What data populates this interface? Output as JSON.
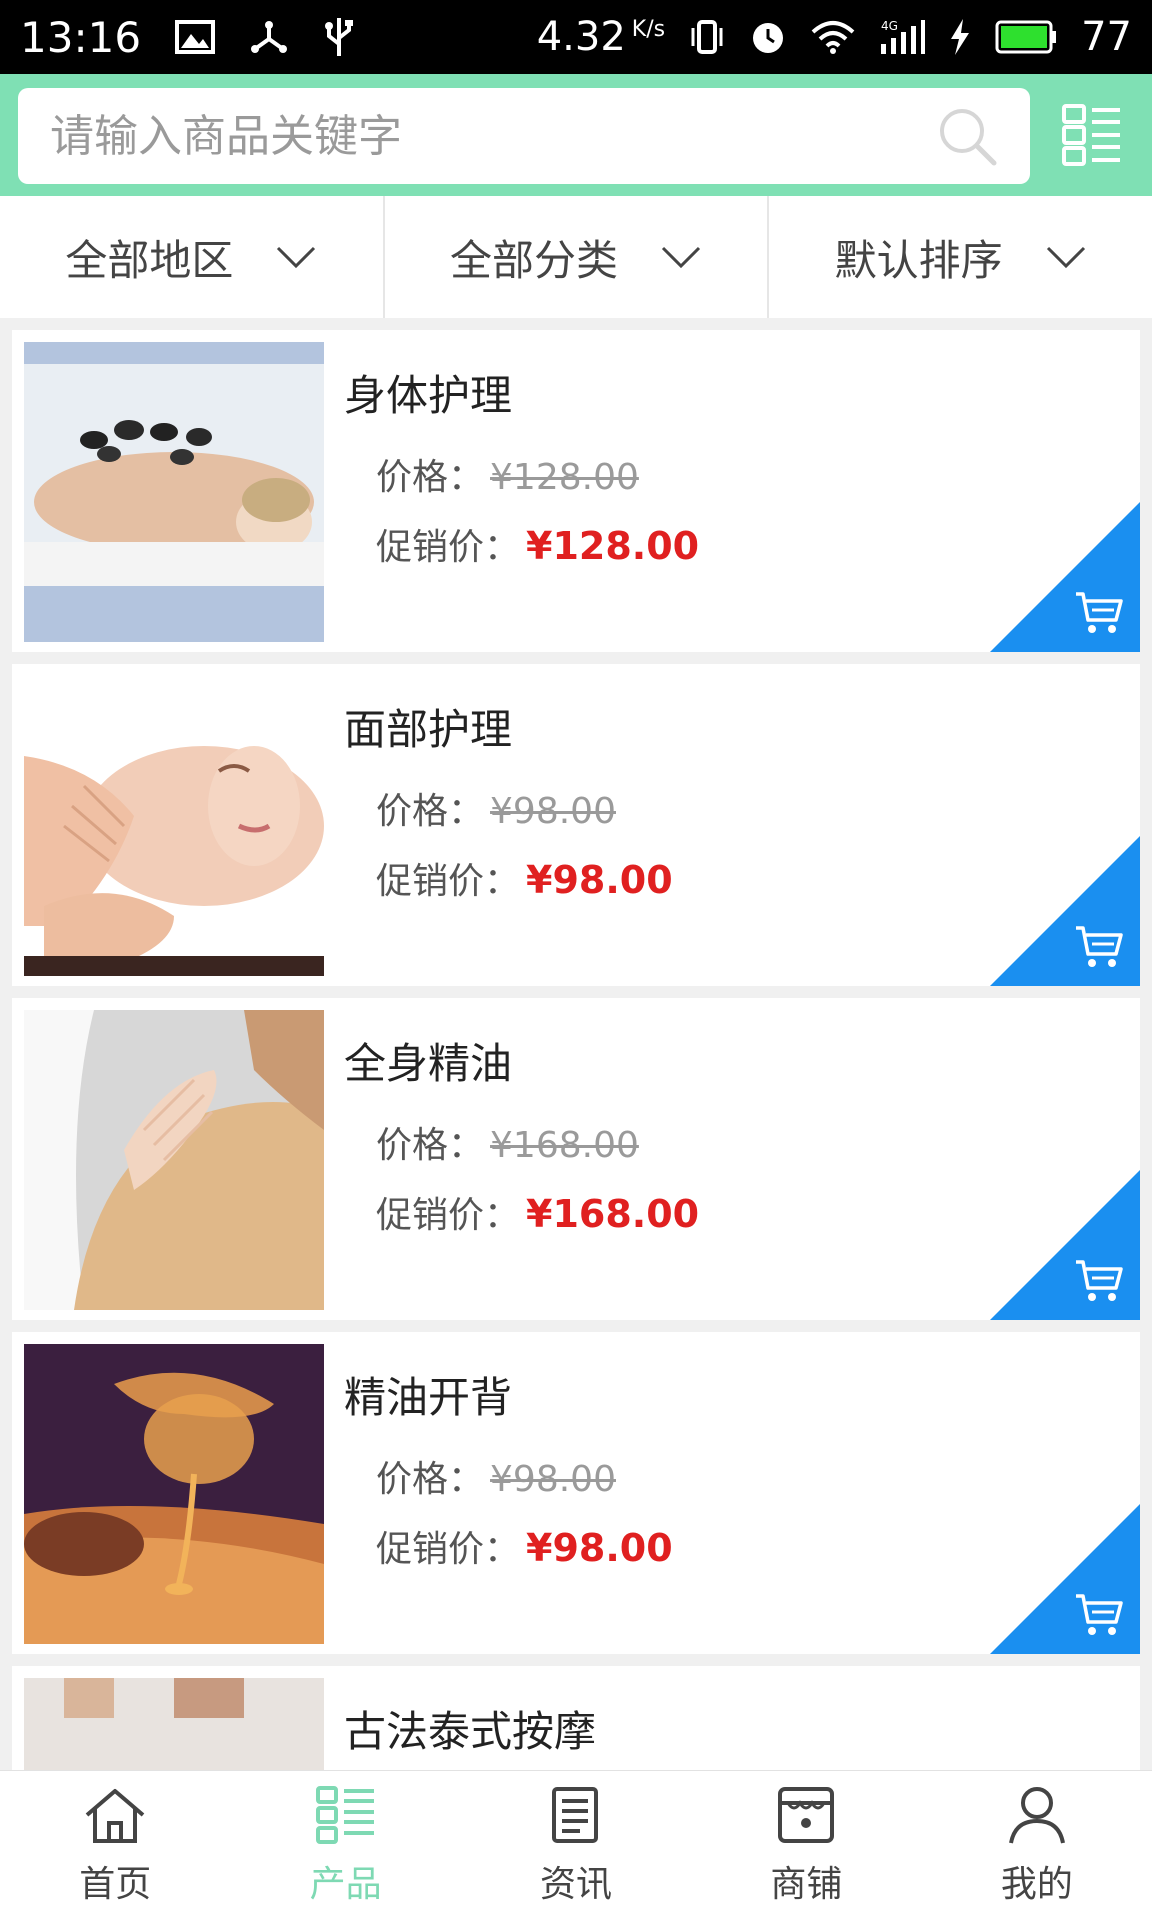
{
  "status_bar": {
    "time": "13:16",
    "speed": "4.32",
    "speed_unit": "K/s",
    "battery": "77",
    "icons": [
      "image-icon",
      "share-icon",
      "usb-icon",
      "vibrate-icon",
      "alarm-icon",
      "wifi-icon",
      "signal-4g-icon",
      "charging-icon",
      "battery-icon"
    ]
  },
  "search": {
    "placeholder": "请输入商品关键字"
  },
  "filters": [
    {
      "label": "全部地区"
    },
    {
      "label": "全部分类"
    },
    {
      "label": "默认排序"
    }
  ],
  "labels": {
    "price": "价格：",
    "promo": "促销价："
  },
  "products": [
    {
      "name": "身体护理",
      "price": "¥128.00",
      "promo_price": "¥128.00"
    },
    {
      "name": "面部护理",
      "price": "¥98.00",
      "promo_price": "¥98.00"
    },
    {
      "name": "全身精油",
      "price": "¥168.00",
      "promo_price": "¥168.00"
    },
    {
      "name": "精油开背",
      "price": "¥98.00",
      "promo_price": "¥98.00"
    },
    {
      "name": "古法泰式按摩",
      "price": "",
      "promo_price": ""
    }
  ],
  "nav": [
    {
      "label": "首页",
      "icon": "home-icon"
    },
    {
      "label": "产品",
      "icon": "product-grid-icon"
    },
    {
      "label": "资讯",
      "icon": "news-icon"
    },
    {
      "label": "商铺",
      "icon": "shop-icon"
    },
    {
      "label": "我的",
      "icon": "user-icon"
    }
  ],
  "colors": {
    "header": "#7fe0b4",
    "accent": "#7ed9b3",
    "promo": "#e02020",
    "cart": "#1a8ff0"
  }
}
